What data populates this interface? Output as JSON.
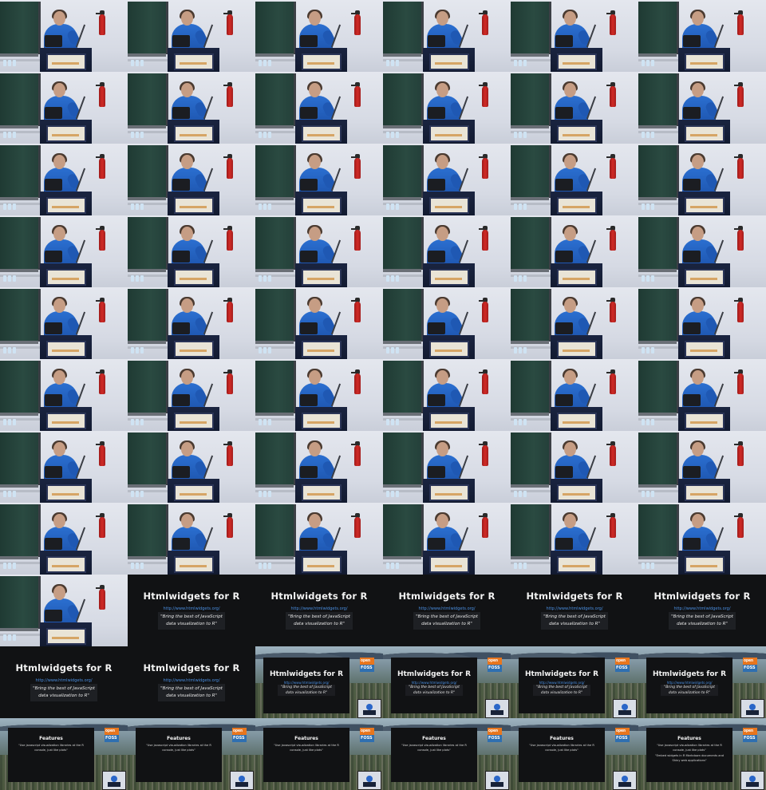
{
  "grid": {
    "columns": 6,
    "rows": 11
  },
  "frames": [
    "speaker",
    "speaker",
    "speaker",
    "speaker",
    "speaker",
    "speaker",
    "speaker",
    "speaker",
    "speaker",
    "speaker",
    "speaker",
    "speaker",
    "speaker",
    "speaker",
    "speaker",
    "speaker",
    "speaker",
    "speaker",
    "speaker",
    "speaker",
    "speaker",
    "speaker",
    "speaker",
    "speaker",
    "speaker",
    "speaker",
    "speaker",
    "speaker",
    "speaker",
    "speaker",
    "speaker",
    "speaker",
    "speaker",
    "speaker",
    "speaker",
    "speaker",
    "speaker",
    "speaker",
    "speaker",
    "speaker",
    "speaker",
    "speaker",
    "speaker",
    "speaker",
    "speaker",
    "speaker",
    "speaker",
    "speaker",
    "speaker",
    "title",
    "title",
    "title",
    "title",
    "title",
    "title",
    "title",
    "landscape-title",
    "landscape-title",
    "landscape-title",
    "landscape-title",
    "features",
    "features",
    "features",
    "features",
    "features",
    "features2"
  ],
  "slide": {
    "title": "Htmlwidgets for R",
    "url": "http://www.htmlwidgets.org/",
    "quote": "\"Bring the best of JavaScript data visualization to R\""
  },
  "features": {
    "title": "Features",
    "text": "\"Use javascript visualization libraries at the R console, just like plots\"",
    "text_alt": "\"Embed widgets in R Markdown documents and Shiny web applications\""
  },
  "logo": {
    "top": "open",
    "bottom": "FOSS"
  },
  "colors": {
    "slide_bg": "#111214",
    "link": "#4a8ee0",
    "shirt": "#2b6fd0",
    "extinguisher": "#d12a25",
    "board": "#2a4a41",
    "logo_orange": "#e8761e",
    "logo_blue": "#2f6fb0"
  }
}
